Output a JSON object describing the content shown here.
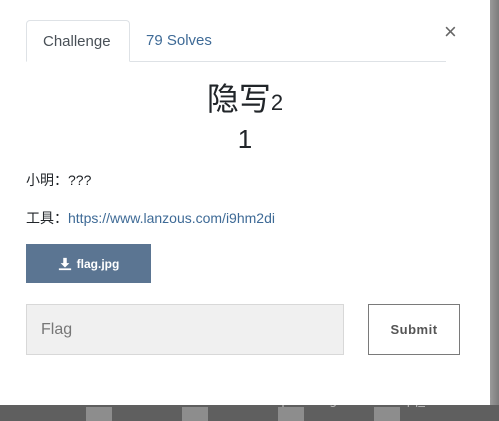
{
  "tabs": [
    {
      "label": "Challenge"
    },
    {
      "label": "79 Solves"
    }
  ],
  "close_icon": "×",
  "challenge": {
    "name": "隐写",
    "name_suffix": "2",
    "value": "1",
    "hint_line": "小明：???",
    "tool_label": "工具：",
    "tool_link": "https://www.lanzous.com/i9hm2di",
    "file_name": "flag.jpg",
    "file_icon": "download-icon"
  },
  "form": {
    "flag_placeholder": "Flag",
    "flag_value": "",
    "submit_label": "Submit"
  },
  "watermark": "https://blog.csdn.net/qq_61999019",
  "colors": {
    "link": "#3e6a96",
    "file_button": "#5b7592"
  }
}
